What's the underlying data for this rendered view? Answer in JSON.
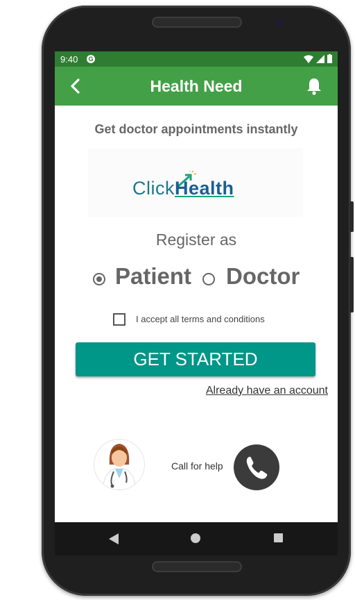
{
  "status_bar": {
    "time": "9:40",
    "app_icon": "G"
  },
  "app_bar": {
    "title": "Health Need",
    "back_icon": "chevron-left-icon",
    "bell_icon": "bell-icon"
  },
  "main": {
    "subtitle": "Get doctor appointments instantly",
    "logo": {
      "click": "Click",
      "health": "Health"
    },
    "register_label": "Register as",
    "roles": [
      {
        "label": "Patient",
        "selected": true
      },
      {
        "label": "Doctor",
        "selected": false
      }
    ],
    "terms_label": "I accept all terms and conditions",
    "terms_checked": false,
    "get_started_label": "GET STARTED",
    "already_account_label": "Already have an account",
    "call_help_label": "Call for help"
  },
  "colors": {
    "status_bar": "#2e7d32",
    "app_bar": "#43a047",
    "button": "#009688",
    "call_button": "#3b3b3b"
  }
}
